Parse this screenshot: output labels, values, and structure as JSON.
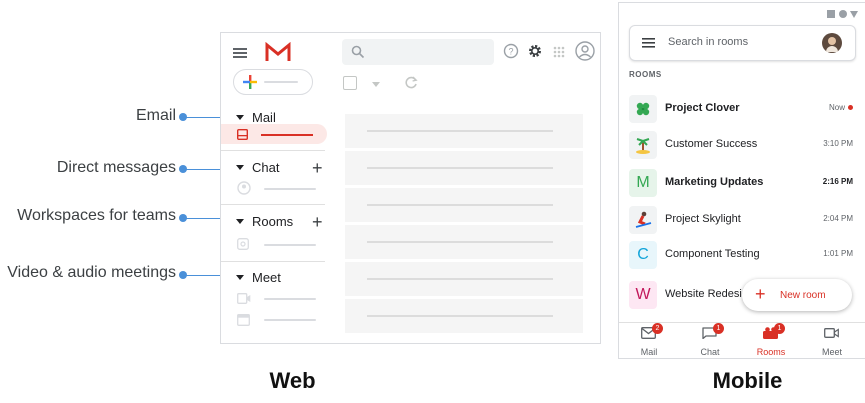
{
  "annotations": [
    {
      "label": "Email"
    },
    {
      "label": "Direct messages"
    },
    {
      "label": "Workspaces for teams"
    },
    {
      "label": "Video & audio meetings"
    }
  ],
  "web": {
    "caption": "Web",
    "sections": {
      "mail": "Mail",
      "chat": "Chat",
      "rooms": "Rooms",
      "meet": "Meet"
    }
  },
  "mobile": {
    "caption": "Mobile",
    "search_placeholder": "Search in rooms",
    "section_header": "ROOMS",
    "rooms": [
      {
        "name": "Project Clover",
        "time": "Now",
        "icon": "clover-icon",
        "bold": true
      },
      {
        "name": "Customer Success",
        "time": "3:10 PM",
        "icon": "island-icon",
        "bold": false
      },
      {
        "name": "Marketing Updates",
        "time": "2:16 PM",
        "icon": "letter-m",
        "bold": true
      },
      {
        "name": "Project Skylight",
        "time": "2:04 PM",
        "icon": "skier-icon",
        "bold": false
      },
      {
        "name": "Component Testing",
        "time": "1:01 PM",
        "icon": "letter-c",
        "bold": false
      },
      {
        "name": "Website Redesig",
        "time": "",
        "icon": "letter-w",
        "bold": false
      }
    ],
    "fab_label": "New room",
    "tabs": [
      {
        "label": "Mail",
        "badge": "2"
      },
      {
        "label": "Chat",
        "badge": "1"
      },
      {
        "label": "Rooms",
        "badge": "1"
      },
      {
        "label": "Meet",
        "badge": ""
      }
    ],
    "colors": {
      "accent": "#d93025",
      "active_tab": "#d93025",
      "fab_text": "#d93025"
    }
  }
}
